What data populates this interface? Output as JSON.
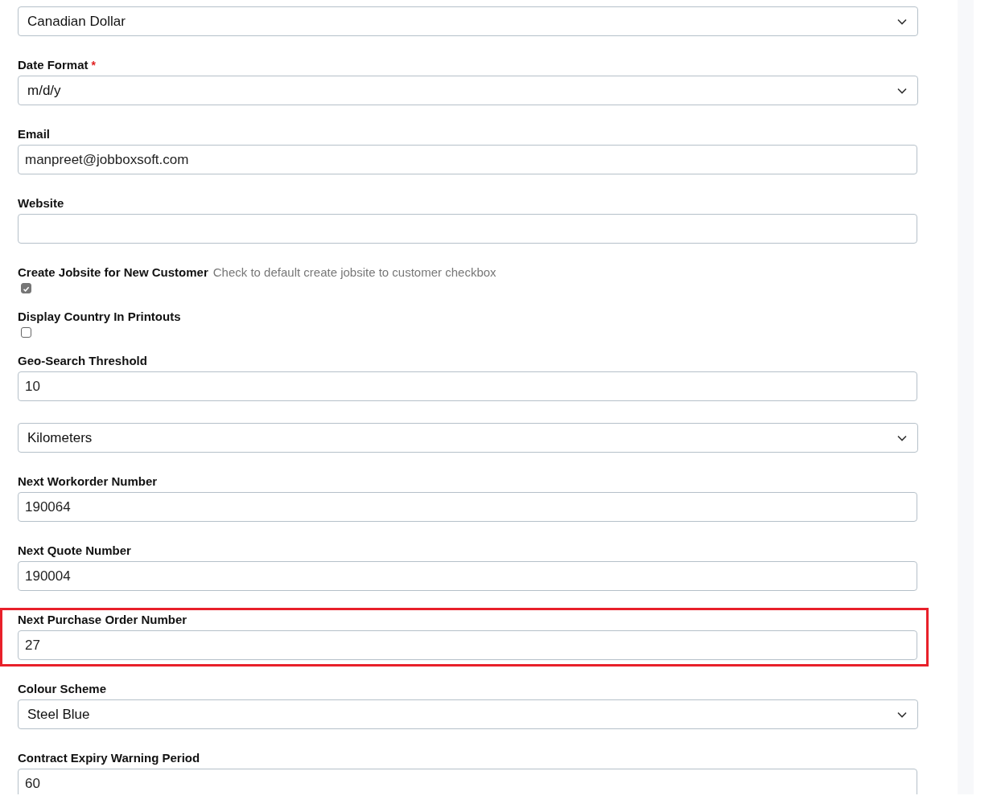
{
  "fields": [
    {
      "kind": "select",
      "value": "Canadian Dollar"
    },
    {
      "kind": "select",
      "label": "Date Format",
      "required_mark": "*",
      "value": "m/d/y"
    },
    {
      "kind": "input",
      "label": "Email",
      "value": "manpreet@jobboxsoft.com"
    },
    {
      "kind": "input",
      "label": "Website"
    },
    {
      "kind": "checkbox",
      "label": "Create Jobsite for New Customer",
      "hint": "Check to default create jobsite to customer checkbox",
      "checked": true
    },
    {
      "kind": "checkbox",
      "label": "Display Country In Printouts",
      "checked": false
    },
    {
      "kind": "input",
      "label": "Geo-Search Threshold",
      "value": "10"
    },
    {
      "kind": "select",
      "value": "Kilometers"
    },
    {
      "kind": "input",
      "label": "Next Workorder Number",
      "value": "190064"
    },
    {
      "kind": "input",
      "label": "Next Quote Number",
      "value": "190004"
    },
    {
      "kind": "input",
      "label": "Next Purchase Order Number",
      "value": "27",
      "highlighted": true
    },
    {
      "kind": "select",
      "label": "Colour Scheme",
      "value": "Steel Blue"
    },
    {
      "kind": "input",
      "label": "Contract Expiry Warning Period",
      "value": "60"
    }
  ]
}
